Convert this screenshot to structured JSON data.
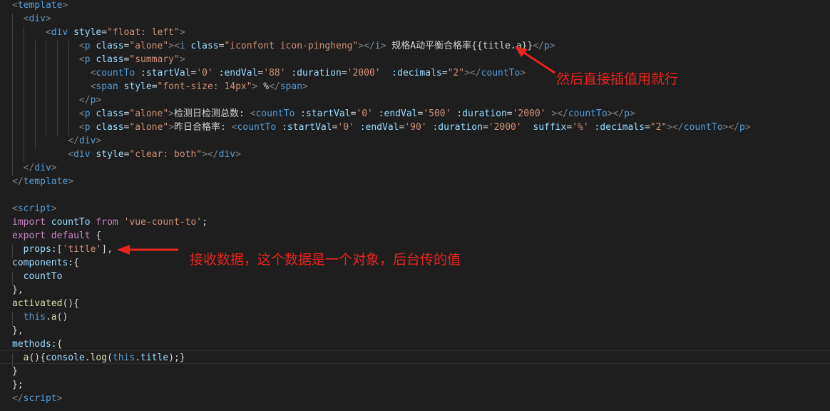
{
  "colors": {
    "background": "#1e1e1e",
    "tag": "#569cd6",
    "punctuation": "#808080",
    "attribute": "#9cdcfe",
    "string": "#ce9178",
    "keyword": "#c586c0",
    "text": "#d4d4d4",
    "annotation": "#e8241c"
  },
  "code_lines": [
    [
      [
        "punct",
        "<"
      ],
      [
        "tag",
        "template"
      ],
      [
        "punct",
        ">"
      ]
    ],
    [
      [
        "punct",
        "  <"
      ],
      [
        "tag",
        "div"
      ],
      [
        "punct",
        ">"
      ]
    ],
    [
      [
        "text",
        "      "
      ],
      [
        "punct",
        "<"
      ],
      [
        "tag",
        "div"
      ],
      [
        "text",
        " "
      ],
      [
        "attr",
        "style"
      ],
      [
        "text",
        "="
      ],
      [
        "str",
        "\"float: left\""
      ],
      [
        "punct",
        ">"
      ]
    ],
    [
      [
        "text",
        "            "
      ],
      [
        "punct",
        "<"
      ],
      [
        "tag",
        "p"
      ],
      [
        "text",
        " "
      ],
      [
        "attr",
        "class"
      ],
      [
        "text",
        "="
      ],
      [
        "str",
        "\"alone\""
      ],
      [
        "punct",
        "><"
      ],
      [
        "tag",
        "i"
      ],
      [
        "text",
        " "
      ],
      [
        "attr",
        "class"
      ],
      [
        "text",
        "="
      ],
      [
        "str",
        "\"iconfont icon-pingheng\""
      ],
      [
        "punct",
        "></"
      ],
      [
        "tag",
        "i"
      ],
      [
        "punct",
        ">"
      ],
      [
        "text",
        " 规格A动平衡合格率{{title.a}}"
      ],
      [
        "punct",
        "</"
      ],
      [
        "tag",
        "p"
      ],
      [
        "punct",
        ">"
      ]
    ],
    [
      [
        "text",
        "            "
      ],
      [
        "punct",
        "<"
      ],
      [
        "tag",
        "p"
      ],
      [
        "text",
        " "
      ],
      [
        "attr",
        "class"
      ],
      [
        "text",
        "="
      ],
      [
        "str",
        "\"summary\""
      ],
      [
        "punct",
        ">"
      ]
    ],
    [
      [
        "text",
        "              "
      ],
      [
        "punct",
        "<"
      ],
      [
        "tag",
        "countTo"
      ],
      [
        "text",
        " "
      ],
      [
        "attr",
        ":startVal"
      ],
      [
        "text",
        "="
      ],
      [
        "str",
        "'0'"
      ],
      [
        "text",
        " "
      ],
      [
        "attr",
        ":endVal"
      ],
      [
        "text",
        "="
      ],
      [
        "str",
        "'88'"
      ],
      [
        "text",
        " "
      ],
      [
        "attr",
        ":duration"
      ],
      [
        "text",
        "="
      ],
      [
        "str",
        "'2000'"
      ],
      [
        "text",
        "  "
      ],
      [
        "attr",
        ":decimals"
      ],
      [
        "text",
        "="
      ],
      [
        "str",
        "\"2\""
      ],
      [
        "punct",
        "></"
      ],
      [
        "tag",
        "countTo"
      ],
      [
        "punct",
        ">"
      ]
    ],
    [
      [
        "text",
        "              "
      ],
      [
        "punct",
        "<"
      ],
      [
        "tag",
        "span"
      ],
      [
        "text",
        " "
      ],
      [
        "attr",
        "style"
      ],
      [
        "text",
        "="
      ],
      [
        "str",
        "\"font-size: 14px\""
      ],
      [
        "punct",
        ">"
      ],
      [
        "text",
        " %"
      ],
      [
        "punct",
        "</"
      ],
      [
        "tag",
        "span"
      ],
      [
        "punct",
        ">"
      ]
    ],
    [
      [
        "text",
        "            "
      ],
      [
        "punct",
        "</"
      ],
      [
        "tag",
        "p"
      ],
      [
        "punct",
        ">"
      ]
    ],
    [
      [
        "text",
        "            "
      ],
      [
        "punct",
        "<"
      ],
      [
        "tag",
        "p"
      ],
      [
        "text",
        " "
      ],
      [
        "attr",
        "class"
      ],
      [
        "text",
        "="
      ],
      [
        "str",
        "\"alone\""
      ],
      [
        "punct",
        ">"
      ],
      [
        "text",
        "检测日检测总数: "
      ],
      [
        "punct",
        "<"
      ],
      [
        "tag",
        "countTo"
      ],
      [
        "text",
        " "
      ],
      [
        "attr",
        ":startVal"
      ],
      [
        "text",
        "="
      ],
      [
        "str",
        "'0'"
      ],
      [
        "text",
        " "
      ],
      [
        "attr",
        ":endVal"
      ],
      [
        "text",
        "="
      ],
      [
        "str",
        "'500'"
      ],
      [
        "text",
        " "
      ],
      [
        "attr",
        ":duration"
      ],
      [
        "text",
        "="
      ],
      [
        "str",
        "'2000'"
      ],
      [
        "text",
        " "
      ],
      [
        "punct",
        "></"
      ],
      [
        "tag",
        "countTo"
      ],
      [
        "punct",
        "></"
      ],
      [
        "tag",
        "p"
      ],
      [
        "punct",
        ">"
      ]
    ],
    [
      [
        "text",
        "            "
      ],
      [
        "punct",
        "<"
      ],
      [
        "tag",
        "p"
      ],
      [
        "text",
        " "
      ],
      [
        "attr",
        "class"
      ],
      [
        "text",
        "="
      ],
      [
        "str",
        "\"alone\""
      ],
      [
        "punct",
        ">"
      ],
      [
        "text",
        "昨日合格率: "
      ],
      [
        "punct",
        "<"
      ],
      [
        "tag",
        "countTo"
      ],
      [
        "text",
        " "
      ],
      [
        "attr",
        ":startVal"
      ],
      [
        "text",
        "="
      ],
      [
        "str",
        "'0'"
      ],
      [
        "text",
        " "
      ],
      [
        "attr",
        ":endVal"
      ],
      [
        "text",
        "="
      ],
      [
        "str",
        "'90'"
      ],
      [
        "text",
        " "
      ],
      [
        "attr",
        ":duration"
      ],
      [
        "text",
        "="
      ],
      [
        "str",
        "'2000'"
      ],
      [
        "text",
        "  "
      ],
      [
        "attr",
        "suffix"
      ],
      [
        "text",
        "="
      ],
      [
        "str",
        "'%'"
      ],
      [
        "text",
        " "
      ],
      [
        "attr",
        ":decimals"
      ],
      [
        "text",
        "="
      ],
      [
        "str",
        "\"2\""
      ],
      [
        "punct",
        "></"
      ],
      [
        "tag",
        "countTo"
      ],
      [
        "punct",
        "></"
      ],
      [
        "tag",
        "p"
      ],
      [
        "punct",
        ">"
      ]
    ],
    [
      [
        "text",
        "          "
      ],
      [
        "punct",
        "</"
      ],
      [
        "tag",
        "div"
      ],
      [
        "punct",
        ">"
      ]
    ],
    [
      [
        "text",
        "          "
      ],
      [
        "punct",
        "<"
      ],
      [
        "tag",
        "div"
      ],
      [
        "text",
        " "
      ],
      [
        "attr",
        "style"
      ],
      [
        "text",
        "="
      ],
      [
        "str",
        "\"clear: both\""
      ],
      [
        "punct",
        "></"
      ],
      [
        "tag",
        "div"
      ],
      [
        "punct",
        ">"
      ]
    ],
    [
      [
        "text",
        "  "
      ],
      [
        "punct",
        "</"
      ],
      [
        "tag",
        "div"
      ],
      [
        "punct",
        ">"
      ]
    ],
    [
      [
        "punct",
        "</"
      ],
      [
        "tag",
        "template"
      ],
      [
        "punct",
        ">"
      ]
    ],
    [],
    [
      [
        "punct",
        "<"
      ],
      [
        "tag",
        "script"
      ],
      [
        "punct",
        ">"
      ]
    ],
    [
      [
        "kw",
        "import"
      ],
      [
        "text",
        " "
      ],
      [
        "var",
        "countTo"
      ],
      [
        "text",
        " "
      ],
      [
        "kw",
        "from"
      ],
      [
        "text",
        " "
      ],
      [
        "str",
        "'vue-count-to'"
      ],
      [
        "text",
        ";"
      ]
    ],
    [
      [
        "kw",
        "export"
      ],
      [
        "text",
        " "
      ],
      [
        "kw",
        "default"
      ],
      [
        "text",
        " {"
      ]
    ],
    [
      [
        "text",
        "  "
      ],
      [
        "var",
        "props"
      ],
      [
        "text",
        ":["
      ],
      [
        "str",
        "'title'"
      ],
      [
        "text",
        "],"
      ]
    ],
    [
      [
        "var",
        "components"
      ],
      [
        "text",
        ":{"
      ]
    ],
    [
      [
        "text",
        "  "
      ],
      [
        "var",
        "countTo"
      ]
    ],
    [
      [
        "text",
        "},"
      ]
    ],
    [
      [
        "fn",
        "activated"
      ],
      [
        "text",
        "(){"
      ]
    ],
    [
      [
        "text",
        "  "
      ],
      [
        "keyw",
        "this"
      ],
      [
        "text",
        "."
      ],
      [
        "fn",
        "a"
      ],
      [
        "text",
        "()"
      ]
    ],
    [
      [
        "text",
        "},"
      ]
    ],
    [
      [
        "var",
        "methods"
      ],
      [
        "text",
        ":{"
      ]
    ],
    [
      [
        "text",
        "  "
      ],
      [
        "fn",
        "a"
      ],
      [
        "text",
        "(){"
      ],
      [
        "var",
        "console"
      ],
      [
        "text",
        "."
      ],
      [
        "fn",
        "log"
      ],
      [
        "text",
        "("
      ],
      [
        "keyw",
        "this"
      ],
      [
        "text",
        "."
      ],
      [
        "var",
        "title"
      ],
      [
        "text",
        ");}"
      ]
    ],
    [
      [
        "text",
        "}"
      ]
    ],
    [
      [
        "text",
        "};"
      ]
    ],
    [
      [
        "punct",
        "</"
      ],
      [
        "tag",
        "script"
      ],
      [
        "punct",
        ">"
      ]
    ]
  ],
  "annotations": {
    "interpolation_note": "然后直接插值用就行",
    "props_note": "接收数据，这个数据是一个对象，后台传的值"
  }
}
